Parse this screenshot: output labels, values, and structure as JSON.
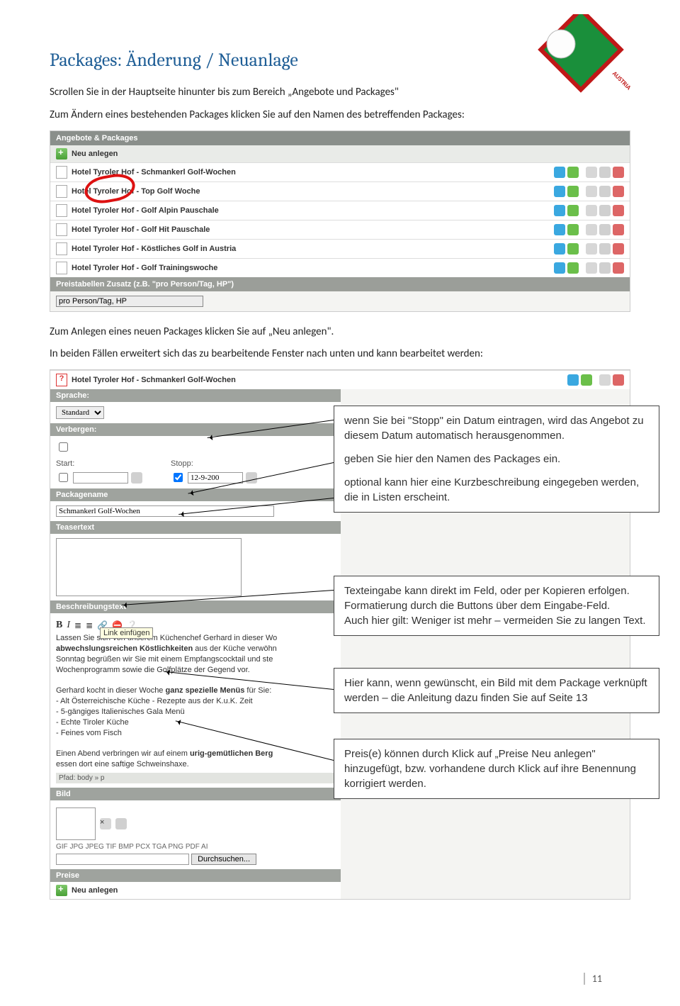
{
  "heading": "Packages: Änderung / Neuanlage",
  "intro": [
    "Scrollen Sie in der Hauptseite hinunter bis zum Bereich „Angebote und Packages\"",
    "Zum Ändern eines bestehenden Packages klicken Sie auf den Namen des betreffenden Packages:"
  ],
  "mid1": "Zum Anlegen eines neuen Packages klicken Sie auf „Neu anlegen\".",
  "mid2": "In beiden Fällen erweitert sich das zu bearbeitende Fenster nach  unten und kann bearbeitet werden:",
  "list": {
    "section": "Angebote & Packages",
    "neu": "Neu anlegen",
    "items": [
      "Hotel Tyroler Hof - Schmankerl Golf-Wochen",
      "Hotel Tyroler Hof - Top Golf Woche",
      "Hotel Tyroler Hof - Golf Alpin Pauschale",
      "Hotel Tyroler Hof - Golf Hit Pauschale",
      "Hotel Tyroler Hof - Köstliches Golf in Austria",
      "Hotel Tyroler Hof - Golf Trainingswoche"
    ],
    "zusatz_label": "Preistabellen Zusatz (z.B. \"pro Person/Tag, HP\")",
    "zusatz_value": "pro Person/Tag, HP"
  },
  "form": {
    "header": "Hotel Tyroler Hof - Schmankerl Golf-Wochen",
    "sprache_label": "Sprache:",
    "sprache_value": "Standard",
    "verbergen_label": "Verbergen:",
    "start_label": "Start:",
    "stopp_label": "Stopp:",
    "stopp_value": "12-9-200",
    "pkg_label": "Packagename",
    "pkg_value": "Schmankerl Golf-Wochen",
    "teaser_label": "Teasertext",
    "beschr_label": "Beschreibungstext",
    "link_tooltip": "Link einfügen",
    "rte_html": "Lassen Sie sich von unserem Küchenchef Gerhard in dieser Wo<br><b>abwechslungsreichen Köstlichkeiten</b> aus der Küche verwöhn<br>Sonntag begrüßen wir Sie mit einem Empfangscocktail und ste<br>Wochenprogramm sowie die Golfplätze der Gegend vor.<br><br>Gerhard kocht in dieser Woche <b>ganz spezielle Menüs</b> für Sie:<br>- Alt Österreichische Küche - Rezepte aus der K.u.K. Zeit<br>- 5-gängiges Italienisches Gala Menü<br>- Echte Tiroler Küche<br>- Feines vom Fisch<br><br>Einen Abend verbringen wir auf einem <b>urig-gemütlichen Berg</b><br>essen dort eine saftige Schweinshaxe.",
    "pfad": "Pfad:  body » p",
    "bild_label": "Bild",
    "types": "GIF JPG JPEG TIF BMP PCX TGA PNG PDF AI",
    "browse": "Durchsuchen...",
    "preise_label": "Preise",
    "preise_neu": "Neu anlegen"
  },
  "callouts": {
    "c1": "wenn Sie bei \"Stopp\" ein Datum eintragen, wird das Angebot zu diesem Datum automatisch herausgenommen.",
    "c2": "geben Sie hier den Namen des Packages ein.",
    "c3": "optional kann hier eine Kurzbeschreibung eingegeben werden, die in Listen erscheint.",
    "c4": "Texteingabe kann direkt im Feld, oder per Kopieren erfolgen. Formatierung durch die Buttons über dem Eingabe-Feld.\nAuch hier gilt: Weniger ist mehr – vermeiden Sie zu langen Text.",
    "c5": "Hier kann, wenn gewünscht, ein Bild mit dem Package verknüpft werden – die Anleitung dazu finden Sie auf Seite 13",
    "c6": "Preis(e) können durch Klick auf „Preise Neu anlegen\" hinzugefügt, bzw. vorhandene durch Klick auf ihre Benennung korrigiert werden."
  },
  "page_number": "11"
}
